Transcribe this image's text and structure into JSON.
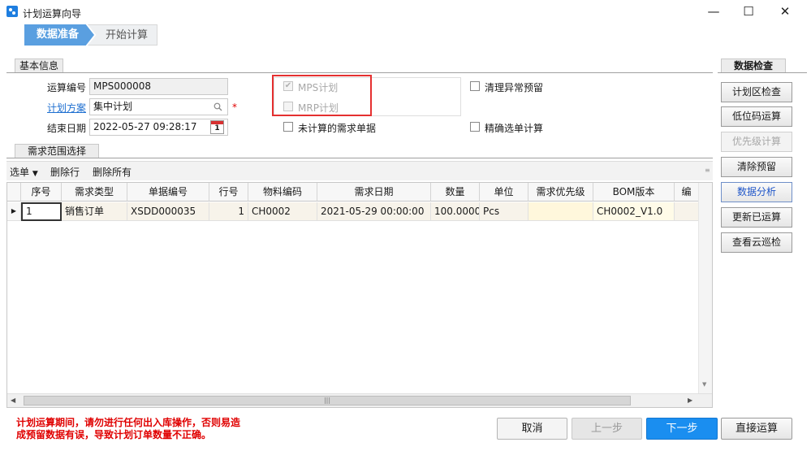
{
  "window": {
    "title": "计划运算向导",
    "minimize": "—",
    "maximize": "☐",
    "close": "✕"
  },
  "wizard": {
    "step_active": "数据准备",
    "step_next": "开始计算"
  },
  "basic_info": {
    "tab": "基本信息",
    "calc_no_label": "运算编号",
    "calc_no_value": "MPS000008",
    "plan_label": "计划方案",
    "plan_value": "集中计划",
    "required_mark": "*",
    "end_date_label": "结束日期",
    "end_date_value": "2022-05-27 09:28:17",
    "calendar_day": "1",
    "mps_label": "MPS计划",
    "mrp_label": "MRP计划",
    "uncalc_label": "未计算的需求单据",
    "clear_reserve_label": "清理异常预留",
    "precise_label": "精确选单计算"
  },
  "demand": {
    "tab": "需求范围选择",
    "toolbar": {
      "select": "选单",
      "delete_row": "删除行",
      "delete_all": "删除所有"
    },
    "columns": [
      "序号",
      "需求类型",
      "单据编号",
      "行号",
      "物料编码",
      "需求日期",
      "数量",
      "单位",
      "需求优先级",
      "BOM版本",
      "编"
    ],
    "rows": [
      {
        "seq": "1",
        "type": "销售订单",
        "bill_no": "XSDD000035",
        "line_no": "1",
        "material": "CH0002",
        "date": "2021-05-29 00:00:00",
        "qty": "100.0000",
        "unit": "Pcs",
        "priority": "",
        "bom": "CH0002_V1.0"
      }
    ],
    "scroll_grip": "|||"
  },
  "right_panel": {
    "tab": "数据检查",
    "buttons": [
      "计划区检查",
      "低位码运算",
      "优先级计算",
      "清除预留",
      "数据分析",
      "更新已运算",
      "查看云巡检"
    ]
  },
  "footer": {
    "warning_line1": "计划运算期间，请勿进行任何出入库操作，否则易造",
    "warning_line2": "成预留数据有误，导致计划订单数量不正确。",
    "cancel": "取消",
    "prev": "上一步",
    "next": "下一步",
    "direct": "直接运算"
  }
}
